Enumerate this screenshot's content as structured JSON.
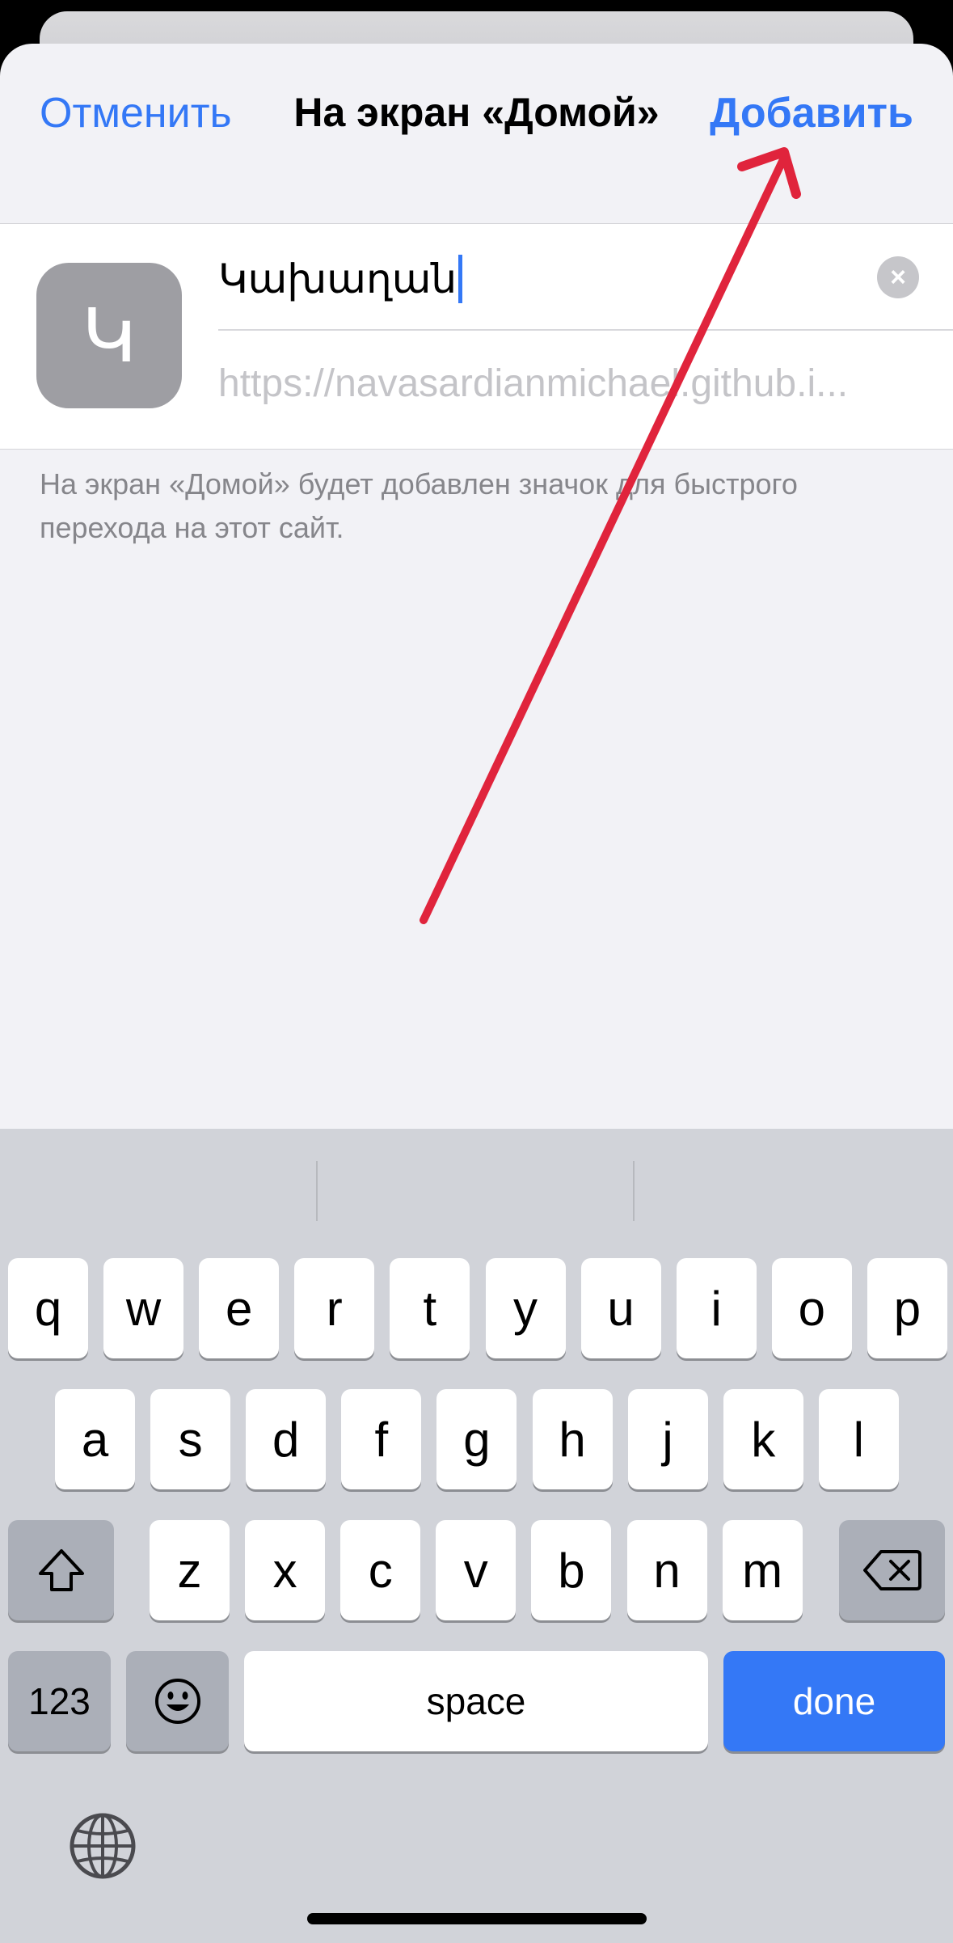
{
  "nav": {
    "cancel_label": "Отменить",
    "title": "На экран «Домой»",
    "add_label": "Добавить"
  },
  "form": {
    "icon_letter": "Կ",
    "name_value": "Կախաղան",
    "url_value": "https://navasardianmichael.github.i...",
    "clear_icon": "×"
  },
  "hint": "На экран «Домой» будет добавлен значок для быстрого перехода на этот сайт.",
  "keyboard": {
    "row1": [
      "q",
      "w",
      "e",
      "r",
      "t",
      "y",
      "u",
      "i",
      "o",
      "p"
    ],
    "row2": [
      "a",
      "s",
      "d",
      "f",
      "g",
      "h",
      "j",
      "k",
      "l"
    ],
    "row3": [
      "z",
      "x",
      "c",
      "v",
      "b",
      "n",
      "m"
    ],
    "numbers_label": "123",
    "emoji_icon": "☺",
    "space_label": "space",
    "done_label": "done"
  },
  "colors": {
    "accent": "#3478f6",
    "arrow": "#e0243c"
  }
}
